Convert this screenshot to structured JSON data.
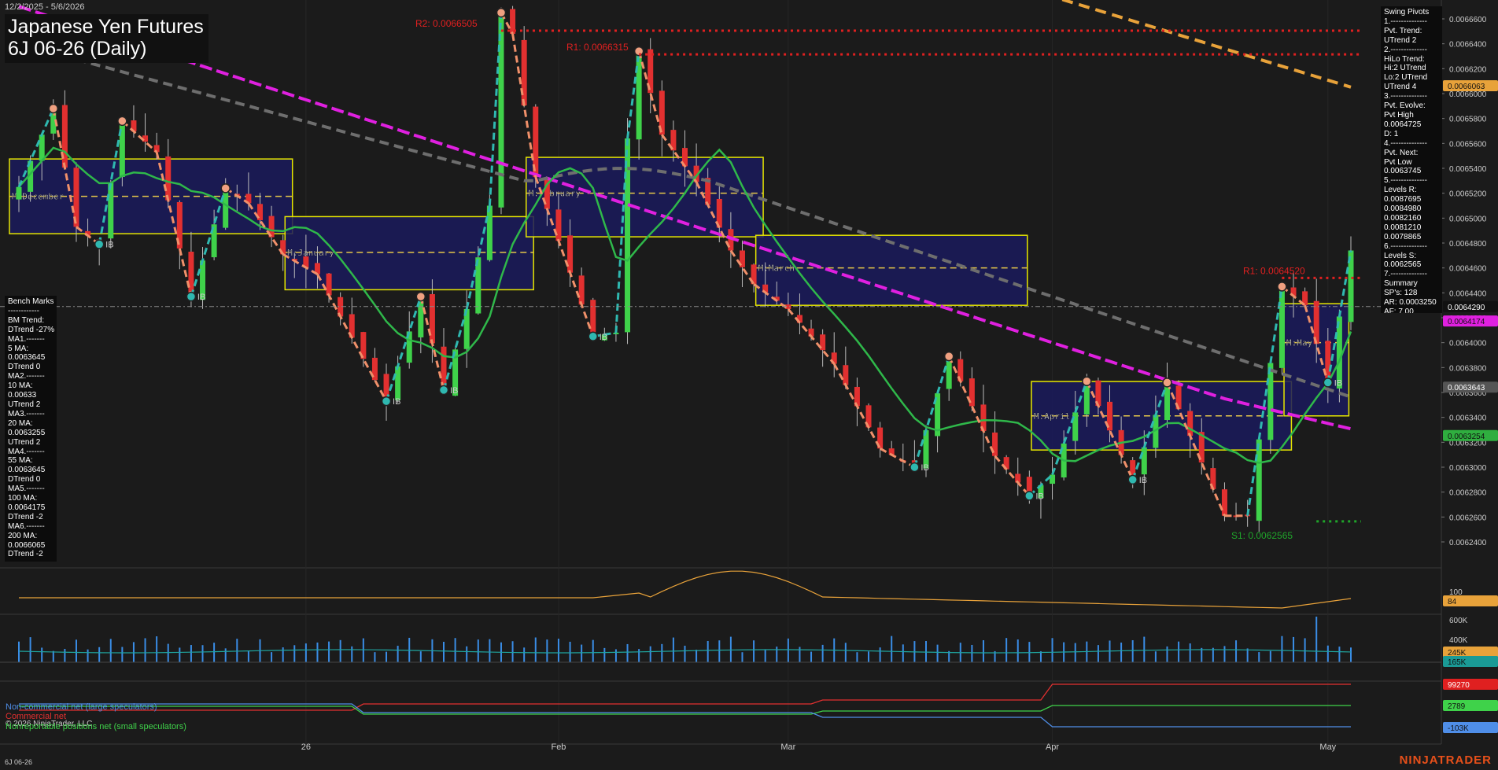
{
  "header": {
    "date_range": "12/2/2025 - 5/6/2026",
    "title_line1": "Japanese Yen Futures",
    "title_line2": "6J 06-26 (Daily)"
  },
  "benchmarks": {
    "lines": [
      "Bench Marks",
      "------------",
      "BM Trend:",
      "DTrend -27%",
      "MA1.-------",
      "5 MA:",
      "0.0063645",
      "DTrend 0",
      "MA2.-------",
      "10 MA:",
      "0.00633",
      "UTrend 2",
      "MA3.-------",
      "20 MA:",
      "0.0063255",
      "UTrend 2",
      "MA4.-------",
      "55 MA:",
      "0.0063645",
      "DTrend 0",
      "MA5.-------",
      "100 MA:",
      "0.0064175",
      "DTrend -2",
      "MA6.-------",
      "200 MA:",
      "0.0066065",
      "DTrend -2"
    ]
  },
  "swing_pivots": {
    "lines": [
      "Swing Pivots",
      "1.--------------",
      "Pvt. Trend:",
      "UTrend 2",
      "2.--------------",
      "HiLo Trend:",
      "Hi:2 UTrend",
      "Lo:2 UTrend",
      "UTrend 4",
      "3.--------------",
      "Pvt. Evolve:",
      "Pvt High",
      "0.0064725",
      "D: 1",
      "4.--------------",
      "Pvt. Next:",
      "Pvt Low",
      "0.0063745",
      "5.--------------",
      "Levels R:",
      "0.0087695",
      "0.0084980",
      "0.0082160",
      "0.0081210",
      "0.0078865",
      "6.--------------",
      "Levels S:",
      "0.0062565",
      "7.--------------",
      "Summary",
      "SP's: 128",
      "AR: 0.0003250",
      "AF: 7.00"
    ]
  },
  "chart_data": {
    "type": "candlestick",
    "y_axis": {
      "ylim": [
        0.006225,
        0.006675
      ],
      "ticks": [
        "0.0066600",
        "0.0066400",
        "0.0066200",
        "0.0066000",
        "0.0065800",
        "0.0065600",
        "0.0065400",
        "0.0065200",
        "0.0065000",
        "0.0064800",
        "0.0064600",
        "0.0064400",
        "0.0064200",
        "0.0064000",
        "0.0063800",
        "0.0063600",
        "0.0063400",
        "0.0063200",
        "0.0063000",
        "0.0062800",
        "0.0062600",
        "0.0062400"
      ]
    },
    "x_axis": {
      "labels": [
        {
          "label": "26",
          "bar": 25
        },
        {
          "label": "Feb",
          "bar": 47
        },
        {
          "label": "Mar",
          "bar": 67
        },
        {
          "label": "Apr",
          "bar": 90
        },
        {
          "label": "May",
          "bar": 114
        }
      ]
    },
    "bar_count": 117,
    "price_points": [
      [
        0,
        6.525
      ],
      [
        3,
        6.588
      ],
      [
        5,
        6.493
      ],
      [
        7,
        6.479
      ],
      [
        9,
        6.578
      ],
      [
        12,
        6.553
      ],
      [
        15,
        6.437
      ],
      [
        18,
        6.524
      ],
      [
        20,
        6.512
      ],
      [
        23,
        6.471
      ],
      [
        26,
        6.455
      ],
      [
        32,
        6.353
      ],
      [
        35,
        6.437
      ],
      [
        37,
        6.362
      ],
      [
        39,
        6.427
      ],
      [
        41,
        6.51
      ],
      [
        42,
        6.665
      ],
      [
        43,
        6.648
      ],
      [
        45,
        6.533
      ],
      [
        50,
        6.405
      ],
      [
        52,
        6.408
      ],
      [
        53,
        6.564
      ],
      [
        54,
        6.634
      ],
      [
        56,
        6.567
      ],
      [
        59,
        6.529
      ],
      [
        62,
        6.474
      ],
      [
        64,
        6.447
      ],
      [
        67,
        6.427
      ],
      [
        71,
        6.383
      ],
      [
        75,
        6.315
      ],
      [
        78,
        6.3
      ],
      [
        81,
        6.389
      ],
      [
        85,
        6.309
      ],
      [
        88,
        6.277
      ],
      [
        90,
        6.294
      ],
      [
        93,
        6.369
      ],
      [
        97,
        6.29
      ],
      [
        100,
        6.368
      ],
      [
        105,
        6.261
      ],
      [
        107,
        6.261
      ],
      [
        110,
        6.445
      ],
      [
        112,
        6.43
      ],
      [
        114,
        6.368
      ],
      [
        116,
        6.474
      ]
    ],
    "moving_averages": [
      {
        "name": "5 MA",
        "value": 0.0063645,
        "trend": "DTrend 0"
      },
      {
        "name": "10 MA",
        "value": 0.00633,
        "trend": "UTrend 2"
      },
      {
        "name": "20 MA",
        "value": 0.0063255,
        "trend": "UTrend 2"
      },
      {
        "name": "55 MA",
        "value": 0.0063645,
        "trend": "DTrend 0"
      },
      {
        "name": "100 MA",
        "value": 0.0064175,
        "trend": "DTrend -2"
      },
      {
        "name": "200 MA",
        "value": 0.0066065,
        "trend": "DTrend -2"
      }
    ],
    "monthly_boxes": [
      {
        "label": "M:December",
        "start_bar": 0,
        "end_bar": 23,
        "high": 6.5475,
        "low": 6.4875,
        "mid": 6.5175
      },
      {
        "label": "M:January",
        "start_bar": 24,
        "end_bar": 44,
        "high": 6.5012,
        "low": 6.4425,
        "mid": 6.4725
      },
      {
        "label": "M:February",
        "start_bar": 45,
        "end_bar": 64,
        "high": 6.5488,
        "low": 6.485,
        "mid": 6.52
      },
      {
        "label": "M:March",
        "start_bar": 65,
        "end_bar": 87,
        "high": 6.4862,
        "low": 6.43,
        "mid": 6.46
      },
      {
        "label": "M:April",
        "start_bar": 89,
        "end_bar": 110,
        "high": 6.3688,
        "low": 6.3138,
        "mid": 6.3412
      },
      {
        "label": "M:May",
        "start_bar": 111,
        "end_bar": 115,
        "high": 6.4313,
        "low": 6.3412,
        "mid": 6.4
      }
    ],
    "levels": [
      {
        "label": "R2: 0.0066505",
        "value": 0.0066505
      },
      {
        "label": "R1: 0.0066315",
        "value": 0.0066315
      },
      {
        "label": "R1: 0.0064520",
        "value": 0.006452
      },
      {
        "label": "S1: 0.0062565",
        "value": 0.0062565
      }
    ],
    "price_tags": [
      {
        "text": "0.0066063",
        "value": 0.0066063,
        "color": "#e8a23a"
      },
      {
        "text": "0.0064290",
        "value": 0.006429,
        "color": "#111111"
      },
      {
        "text": "0.0064174",
        "value": 0.0064174,
        "color": "#e020e0"
      },
      {
        "text": "0.0063643",
        "value": 0.0063643,
        "color": "#555555"
      },
      {
        "text": "0.0063254",
        "value": 0.0063254,
        "color": "#2fae3f"
      }
    ],
    "pivot_labels": [
      "IB",
      "IB",
      "IB",
      "IB",
      "IB",
      "IB",
      "IB",
      "IB",
      "IB",
      "IB",
      "IB",
      "IB",
      "IB",
      "IB",
      "IB",
      "IB",
      "IB",
      "IB"
    ],
    "sub_panels": [
      {
        "name": "oscillator",
        "ticks": [
          "100"
        ],
        "value_tag": "84"
      },
      {
        "name": "volume",
        "ticks": [
          "600K",
          "400K"
        ],
        "value_tags": [
          "245K",
          "165K"
        ]
      },
      {
        "name": "cot",
        "value_tags": [
          "99270",
          "2789",
          "-103K"
        ],
        "legend": [
          "Non-commercial net (large speculators)",
          "Commercial net",
          "Nonreportable positions net (small speculators)"
        ]
      }
    ]
  },
  "footer": {
    "copyright": "© 2026 NinjaTrader, LLC",
    "symbol": "6J 06-26",
    "brand": "NINJATRADER"
  },
  "colors": {
    "background": "#1b1b1b",
    "bull": "#3fd24a",
    "bear": "#e23030",
    "resistance": "#e02020",
    "support": "#1fa52a",
    "ma_magenta": "#e020e0",
    "ma_orange": "#e8a23a",
    "ma_gray": "#777777",
    "ma_green": "#2fb84a",
    "month_box_fill": "#1a1a5c",
    "month_box_border": "#e6e600"
  }
}
